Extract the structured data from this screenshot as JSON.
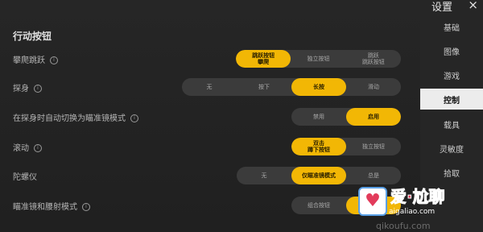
{
  "section_title": "行动按钮",
  "rows": [
    {
      "label": "攀爬跳跃",
      "options": [
        "跳跃按钮\n攀爬",
        "独立按钮",
        "跳跃\n跳跃按钮"
      ],
      "selected": 0
    },
    {
      "label": "探身",
      "options": [
        "无",
        "按下",
        "长按",
        "滑动"
      ],
      "selected": 2
    },
    {
      "label": "在探身时自动切换为瞄准镜模式",
      "options": [
        "禁用",
        "启用"
      ],
      "selected": 1
    },
    {
      "label": "滚动",
      "options": [
        "双击\n蹲下按钮",
        "独立按钮"
      ],
      "selected": 0
    },
    {
      "label": "陀螺仪",
      "options": [
        "无",
        "仅瞄准镜模式",
        "总是"
      ],
      "selected": 1
    },
    {
      "label": "瞄准镜和腰射模式",
      "options": [
        "组合按钮",
        ""
      ],
      "selected": 1
    }
  ],
  "sidebar": {
    "title": "设置",
    "close": "×",
    "items": [
      "基础",
      "图像",
      "游戏",
      "控制",
      "载具",
      "灵敏度",
      "拾取"
    ],
    "active_index": 3
  },
  "watermark": {
    "heart": "♥",
    "brand": "爱·尬聊",
    "url": "aigaliao.com",
    "foot": "qikoufu.com"
  },
  "colors": {
    "accent": "#f2b705",
    "active_nav": "#ececec"
  }
}
